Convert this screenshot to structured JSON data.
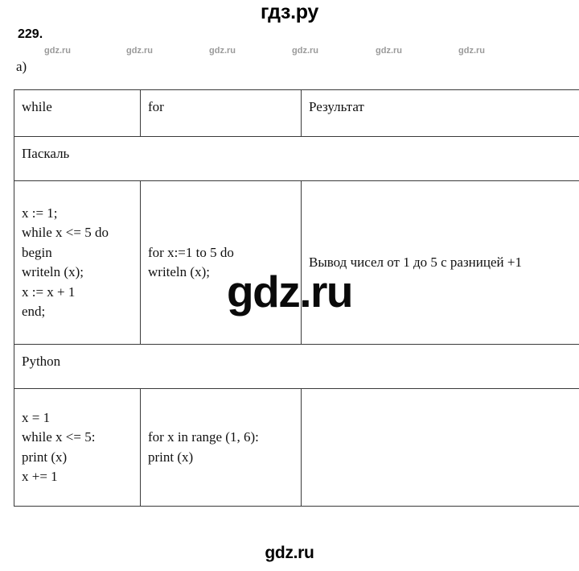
{
  "branding": {
    "top_logo": "гдз.ру",
    "bottom_logo": "gdz.ru",
    "center_watermark": "gdz.ru",
    "small_watermark": "gdz.ru",
    "small_watermark_positions": [
      55,
      157,
      260,
      363,
      467,
      570
    ],
    "small_watermark_count": 6
  },
  "task": {
    "number": "229.",
    "sub_label": "a)"
  },
  "table": {
    "columns": [
      {
        "key": "while",
        "header": "while"
      },
      {
        "key": "for",
        "header": "for"
      },
      {
        "key": "result",
        "header": "Результат"
      }
    ],
    "sections": [
      {
        "language": "Паскаль",
        "while_code": "x := 1;\nwhile x <= 5 do\nbegin\nwriteln (x);\nx := x + 1\nend;",
        "for_code": "for x:=1 to 5 do\nwriteln (x);",
        "result": "Вывод чисел от 1 до 5 с разницей +1"
      },
      {
        "language": "Python",
        "while_code": "x = 1\nwhile x <= 5:\nprint (x)\nx += 1",
        "for_code": "for x in range (1, 6):\nprint (x)",
        "result": ""
      }
    ]
  },
  "colors": {
    "page_background": "#ffffff",
    "text": "#111111",
    "border": "#3a3a3a",
    "watermark_small": "#9a9a9a",
    "watermark_big": "#0a0a0a"
  }
}
